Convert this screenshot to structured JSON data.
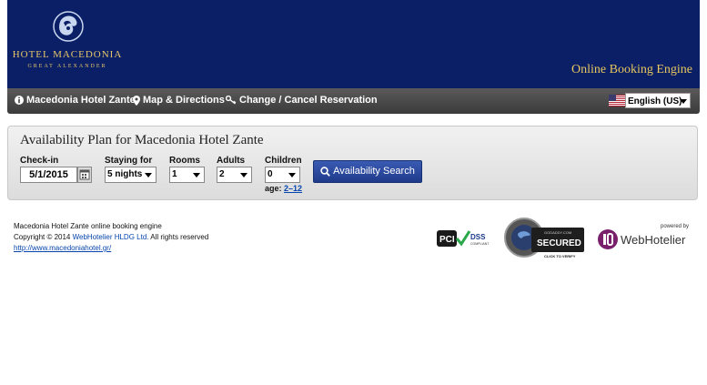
{
  "header": {
    "logo_title": "HOTEL MACEDONIA",
    "logo_subtitle": "GREAT ALEXANDER",
    "engine_title": "Online Booking Engine"
  },
  "nav": {
    "items": [
      {
        "label": "Macedonia Hotel Zante",
        "icon": "info-icon"
      },
      {
        "label": "Map & Directions",
        "icon": "map-marker-icon"
      },
      {
        "label": "Change / Cancel Reservation",
        "icon": "key-icon"
      }
    ],
    "language": "English (US)",
    "language_flag": "us-flag-icon"
  },
  "search": {
    "title": "Availability Plan for Macedonia Hotel Zante",
    "checkin_label": "Check-in",
    "checkin_value": "5/1/2015",
    "staying_label": "Staying for",
    "staying_value": "5 nights",
    "rooms_label": "Rooms",
    "rooms_value": "1",
    "adults_label": "Adults",
    "adults_value": "2",
    "children_label": "Children",
    "children_value": "0",
    "age_label": "age:",
    "age_range": "2–12",
    "button_label": "Availability Search"
  },
  "footer": {
    "line1": "Macedonia Hotel Zante online booking engine",
    "copyright": "Copyright © 2014",
    "company": "WebHotelier HLDG Ltd.",
    "rights": "All rights reserved",
    "url": "http://www.macedoniahotel.gr/",
    "badges": {
      "pci": "PCI DSS",
      "pci_sub": "COMPLIANT",
      "seal_top": "GODADDY.COM",
      "seal_main": "SECURED",
      "seal_bottom": "CLICK TO VERIFY",
      "powered_by": "powered by",
      "webhotelier": "WebHotelier"
    }
  },
  "colors": {
    "header_bg": "#0a1f66",
    "gold": "#e7c75d",
    "nav_bg": "#4a4a4a",
    "button_bg": "#2b49a0",
    "link": "#0645ad"
  }
}
